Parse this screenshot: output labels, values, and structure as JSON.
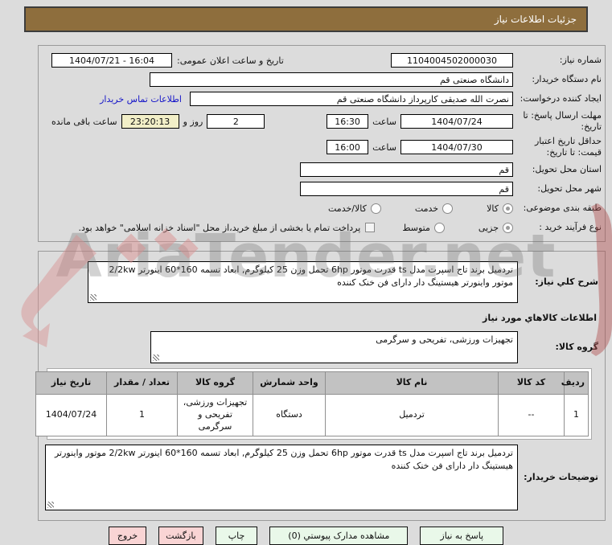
{
  "title": "جزئیات اطلاعات نیاز",
  "watermark": "AriaTender.net",
  "form": {
    "need_number_label": "شماره نیاز:",
    "need_number": "1104004502000030",
    "announce_label": "تاریخ و ساعت اعلان عمومی:",
    "announce_value": "1404/07/21 - 16:04",
    "buyer_org_label": "نام دستگاه خریدار:",
    "buyer_org": "دانشگاه صنعتی قم",
    "creator_label": "ایجاد کننده درخواست:",
    "creator": "نصرت الله صدیقی کارپرداز دانشگاه صنعتی قم",
    "contact_link": "اطلاعات تماس خریدار",
    "deadline_label": "مهلت ارسال پاسخ: تا تاریخ:",
    "deadline_date": "1404/07/24",
    "hour_label": "ساعت",
    "deadline_time": "16:30",
    "remaining_days": "2",
    "remaining_middle": "روز و",
    "remaining_time": "23:20:13",
    "remaining_suffix": "ساعت باقی مانده",
    "validity_label": "حداقل تاریخ اعتبار قیمت: تا تاریخ:",
    "validity_date": "1404/07/30",
    "validity_time": "16:00",
    "province_label": "استان محل تحویل:",
    "province": "قم",
    "city_label": "شهر محل تحویل:",
    "city": "قم",
    "category_label": "طبقه بندی موضوعی:",
    "category_options": [
      {
        "label": "کالا",
        "selected": true
      },
      {
        "label": "خدمت",
        "selected": false
      },
      {
        "label": "کالا/خدمت",
        "selected": false
      }
    ],
    "process_label": "نوع فرآیند خرید :",
    "process_options": [
      {
        "label": "جزیی",
        "selected": true
      },
      {
        "label": "متوسط",
        "selected": false
      }
    ],
    "treasury_checkbox_label": "پرداخت تمام یا بخشی از مبلغ خرید،از محل \"اسناد خزانه اسلامی\" خواهد بود.",
    "treasury_checked": false
  },
  "need": {
    "summary_label": "شرح کلي نیاز:",
    "summary": "تردمیل برند تاج اسپرت مدل ts قدرت موتور 6hp تحمل وزن 25 کیلوگرم, ابعاد تسمه 160*60 اینورتر 2/2kw موتور واینورتر هیستینگ دار دارای فن خنک کننده",
    "items_header": "اطلاعات کالاهاي مورد نیاز",
    "group_label": "گروه کالا:",
    "group_value": "تجهیزات ورزشی، تفریحی و سرگرمی",
    "table": {
      "headers": [
        "ردیف",
        "کد کالا",
        "نام کالا",
        "واحد شمارش",
        "گروه کالا",
        "تعداد / مقدار",
        "تاریخ نیاز"
      ],
      "rows": [
        [
          "1",
          "--",
          "تردمیل",
          "دستگاه",
          "تجهیزات ورزشی، تفریحی و سرگرمی",
          "1",
          "1404/07/24"
        ]
      ]
    },
    "notes_label": "توضیحات خریدار:",
    "notes": "تردمیل برند تاج اسپرت مدل ts قدرت موتور 6hp تحمل وزن 25 کیلوگرم, ابعاد تسمه 160*60 اینورتر 2/2kw موتور واینورتر هیستینگ دار دارای فن خنک کننده"
  },
  "buttons": {
    "respond": "پاسخ به نیاز",
    "attachments": "مشاهده مدارک پیوستي (0)",
    "print": "چاپ",
    "back": "بازگشت",
    "exit": "خروج"
  }
}
